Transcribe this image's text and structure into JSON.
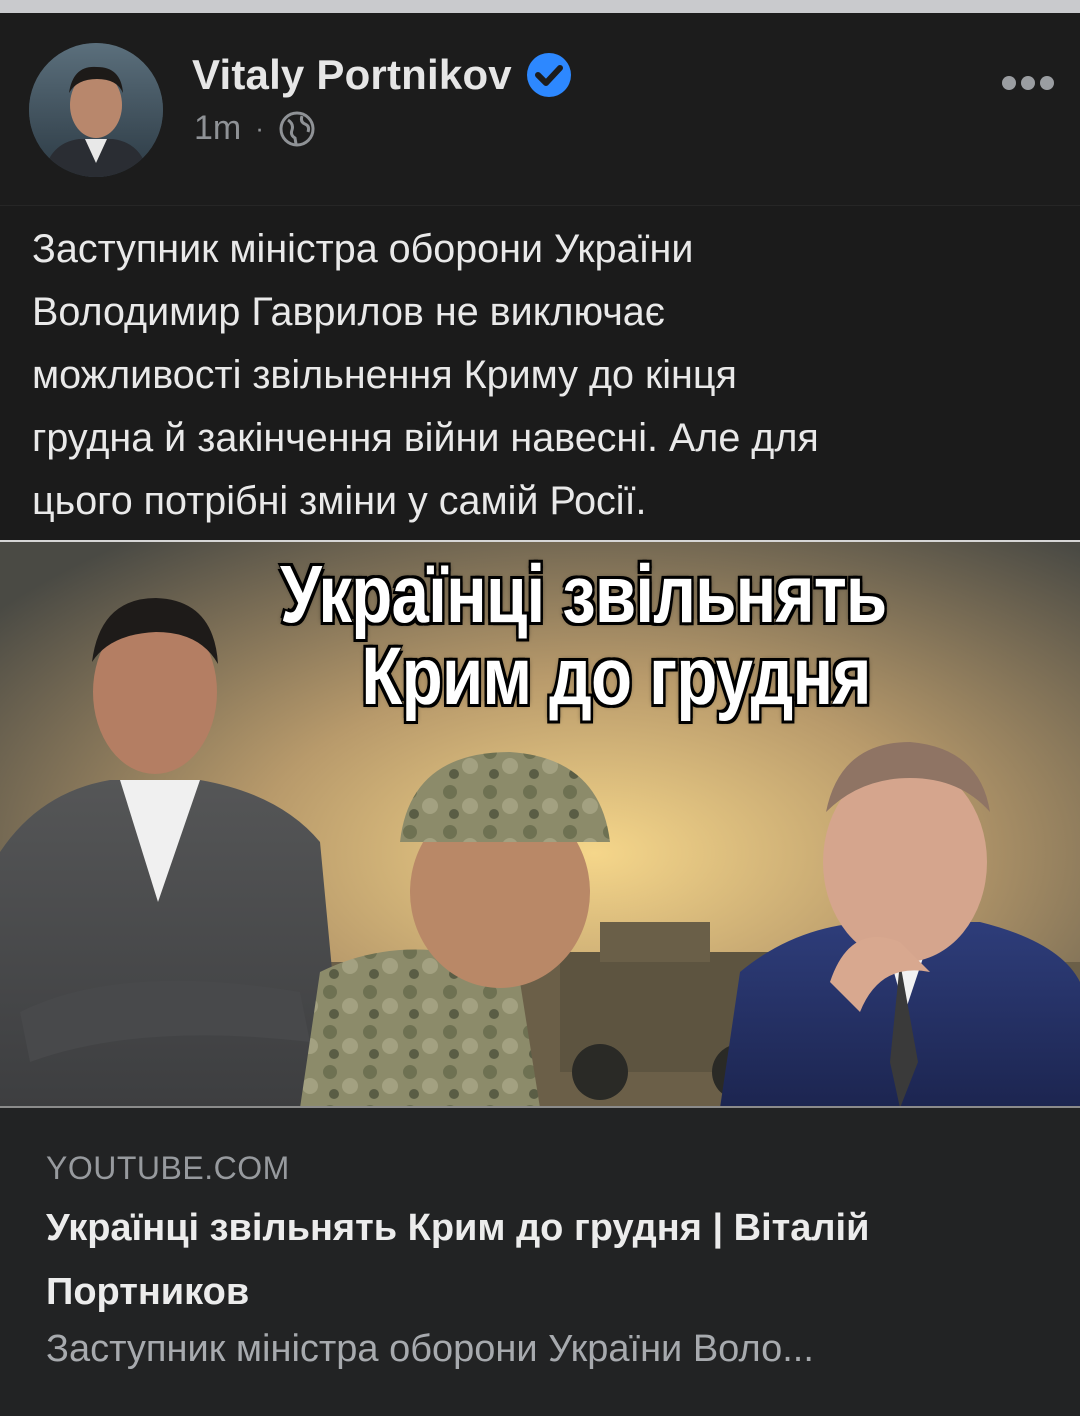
{
  "post": {
    "author": "Vitaly Portnikov",
    "time": "1m",
    "separator": "·",
    "audience_icon": "globe-icon",
    "verified_icon": "verified-badge-icon",
    "more_icon": "more-options-icon",
    "text": "Заступник міністра оборони України\nВолодимир Гаврилов не виключає\nможливості звільнення Криму до кінця\nгрудна й закінчення війни навесні.  Але для\nцього потрібні зміни у самій Росії."
  },
  "thumbnail": {
    "headline_line1": "Українці звільнять",
    "headline_line2": "Крим до грудня"
  },
  "link": {
    "domain": "YOUTUBE.COM",
    "title": "Українці звільнять Крим до грудня | Віталій Портников",
    "description": "Заступник міністра оборони України Воло..."
  },
  "colors": {
    "background": "#1b1b1b",
    "card": "#222324",
    "verified": "#2d88ff"
  }
}
